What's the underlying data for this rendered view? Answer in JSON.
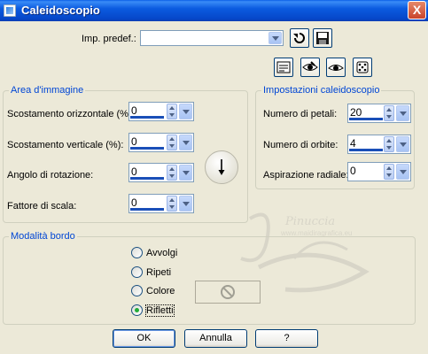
{
  "window": {
    "title": "Caleidoscopio",
    "close_label": "X"
  },
  "preset": {
    "label": "Imp. predef.:",
    "value": ""
  },
  "image_area": {
    "legend": "Area d'immagine",
    "fields": [
      {
        "label": "Scostamento orizzontale (%):",
        "value": "0"
      },
      {
        "label": "Scostamento verticale (%):",
        "value": "0"
      },
      {
        "label": "Angolo di rotazione:",
        "value": "0"
      },
      {
        "label": "Fattore di scala:",
        "value": "0"
      }
    ]
  },
  "kaleido_settings": {
    "legend": "Impostazioni caleidoscopio",
    "fields": [
      {
        "label": "Numero di petali:",
        "value": "20"
      },
      {
        "label": "Numero di orbite:",
        "value": "4"
      },
      {
        "label": "Aspirazione radiale:",
        "value": "0"
      }
    ]
  },
  "edge_mode": {
    "legend": "Modalità bordo",
    "options": [
      {
        "label": "Avvolgi",
        "selected": false
      },
      {
        "label": "Ripeti",
        "selected": false
      },
      {
        "label": "Colore",
        "selected": false
      },
      {
        "label": "Rifletti",
        "selected": true
      }
    ]
  },
  "buttons": {
    "ok": "OK",
    "cancel": "Annulla",
    "help": "?"
  },
  "watermark": {
    "name": "Pinuccia",
    "url": "www.maidiragrafica.eu"
  },
  "colors": {
    "accent": "#0046d5",
    "titlebar": "#0a5fe6",
    "value_bar": "#1a4fb8",
    "radio_on": "#22ac38"
  }
}
